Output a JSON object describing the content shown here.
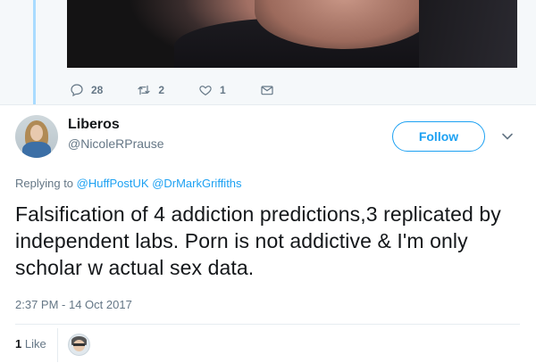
{
  "previous_tweet": {
    "reply_count": "28",
    "retweet_count": "2",
    "like_count": "1"
  },
  "tweet": {
    "display_name": "Liberos",
    "handle": "@NicoleRPrause",
    "follow_label": "Follow",
    "replying_prefix": "Replying to",
    "mentions": [
      "@HuffPostUK",
      "@DrMarkGriffiths"
    ],
    "text": "Falsification of 4 addiction predictions,3 replicated by independent labs. Porn is not addictive & I'm only scholar w actual sex data.",
    "timestamp": "2:37 PM - 14 Oct 2017",
    "likes_count": "1",
    "likes_label": "Like"
  },
  "icons": {
    "reply": "reply-icon",
    "retweet": "retweet-icon",
    "like": "heart-icon",
    "dm": "envelope-icon",
    "more": "chevron-down-icon"
  },
  "colors": {
    "accent": "#1da1f2",
    "secondary_text": "#657786",
    "thread_line": "#a9dbff"
  }
}
